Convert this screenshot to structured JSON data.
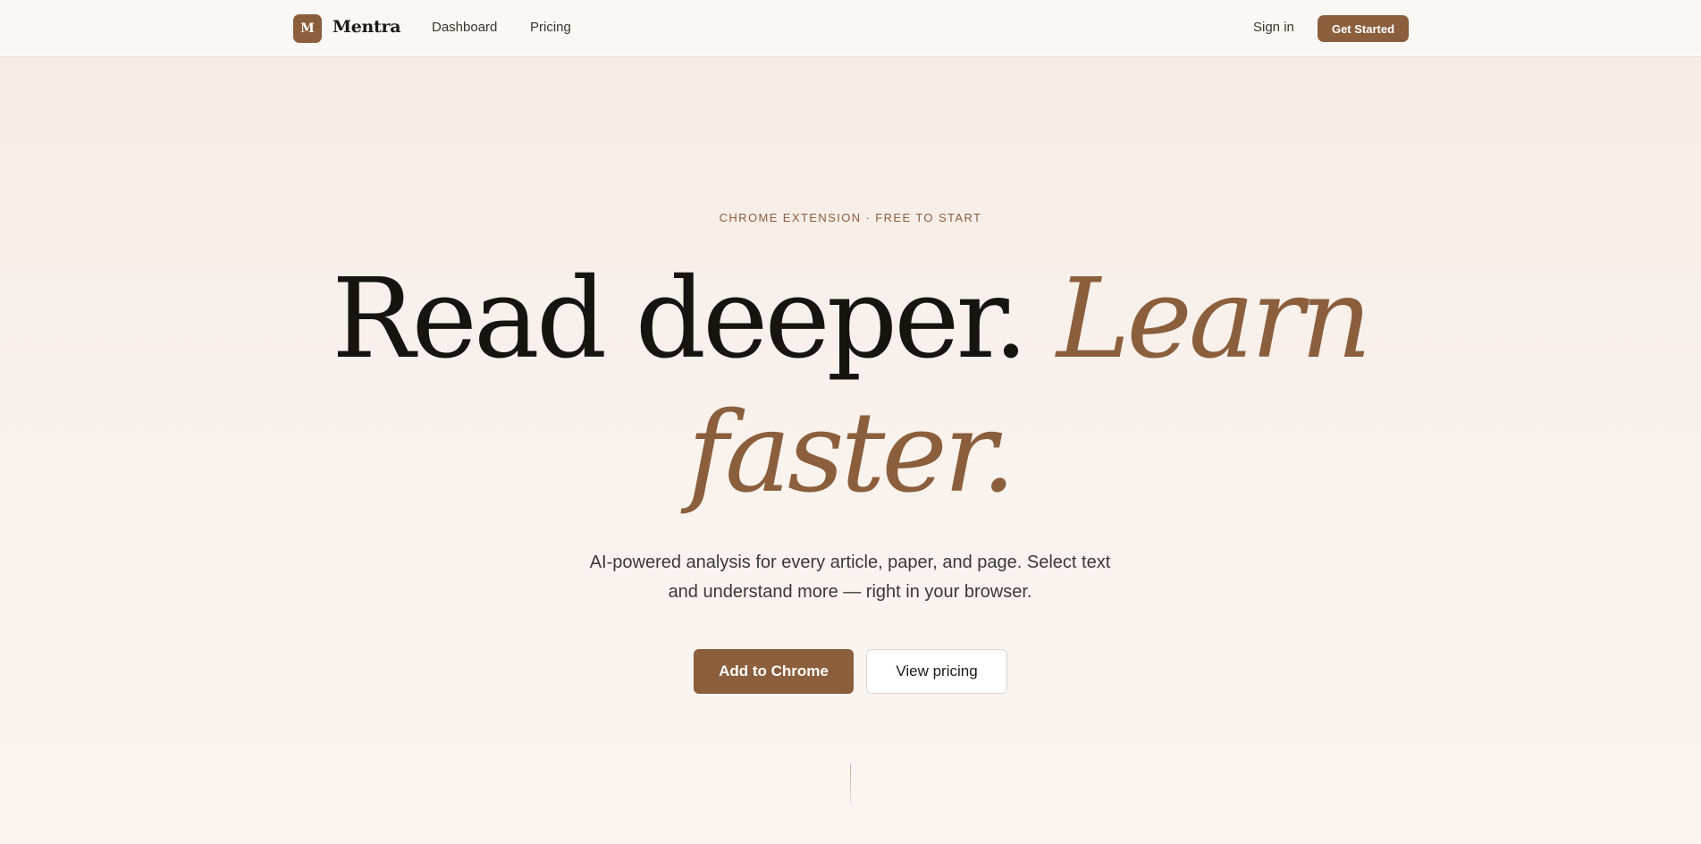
{
  "nav": {
    "logo_letter": "M",
    "brand": "Mentra",
    "links": [
      "Dashboard",
      "Pricing"
    ],
    "signin": "Sign in",
    "cta": "Get Started"
  },
  "hero": {
    "eyebrow": "CHROME EXTENSION · FREE TO START",
    "headline_plain": "Read deeper. ",
    "headline_accent": "Learn faster.",
    "subtext": "AI-powered analysis for every article, paper, and page. Select text and understand more — right in your browser.",
    "primary_button": "Add to Chrome",
    "secondary_button": "View pricing"
  },
  "colors": {
    "accent": "#8b5e3c",
    "background": "#f8efe9",
    "text": "#17140f"
  },
  "icons": {
    "scroll_indicator": "vertical-line"
  }
}
